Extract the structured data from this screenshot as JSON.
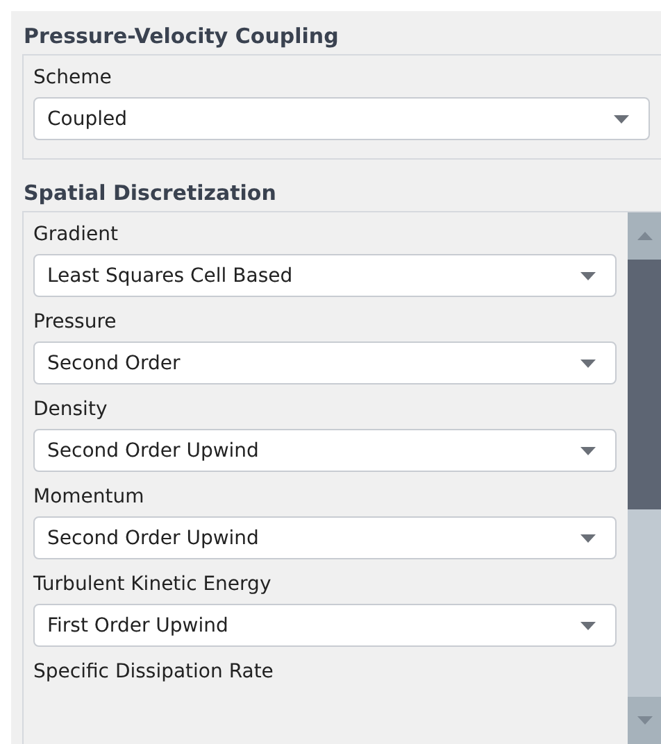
{
  "pressure_velocity_coupling": {
    "title": "Pressure-Velocity Coupling",
    "fields": [
      {
        "label": "Scheme",
        "value": "Coupled"
      }
    ]
  },
  "spatial_discretization": {
    "title": "Spatial Discretization",
    "fields": [
      {
        "label": "Gradient",
        "value": "Least Squares Cell Based"
      },
      {
        "label": "Pressure",
        "value": "Second Order"
      },
      {
        "label": "Density",
        "value": "Second Order Upwind"
      },
      {
        "label": "Momentum",
        "value": "Second Order Upwind"
      },
      {
        "label": "Turbulent Kinetic Energy",
        "value": "First Order Upwind"
      },
      {
        "label": "Specific Dissipation Rate"
      }
    ]
  }
}
